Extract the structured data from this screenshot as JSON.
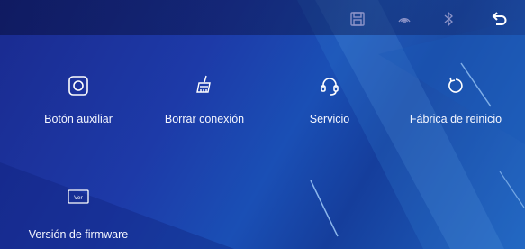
{
  "topbar": {
    "icons": [
      "save-icon",
      "nfc-icon",
      "bluetooth-icon",
      "back-icon"
    ]
  },
  "menu": {
    "items": [
      {
        "label": "Botón auxiliar",
        "icon": "aux-button-icon"
      },
      {
        "label": "Borrar conexión",
        "icon": "broom-icon"
      },
      {
        "label": "Servicio",
        "icon": "headset-icon"
      },
      {
        "label": "Fábrica de reinicio",
        "icon": "reset-icon"
      },
      {
        "label": "Versión de firmware",
        "icon": "version-icon"
      }
    ]
  },
  "colors": {
    "background": "#1d3aa8",
    "topbar": "#0c1650",
    "text": "#ffffff",
    "icon_dim": "#8c93c8"
  }
}
